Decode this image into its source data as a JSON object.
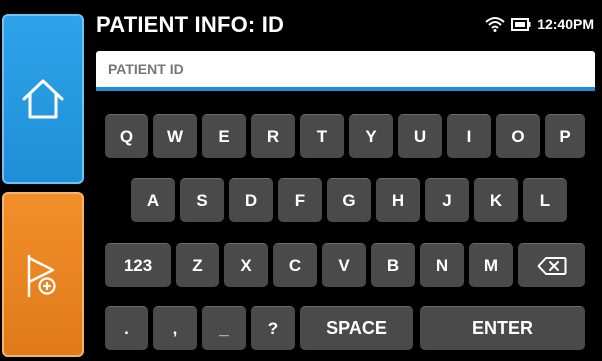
{
  "header": {
    "title": "PATIENT INFO: ID",
    "time": "12:40PM"
  },
  "status_icons": [
    "wifi-icon",
    "battery-icon"
  ],
  "sidebar": {
    "home_icon": "home-icon",
    "flag_icon": "flag-add-icon"
  },
  "input": {
    "placeholder": "PATIENT ID",
    "value": ""
  },
  "keyboard": {
    "row1": [
      "Q",
      "W",
      "E",
      "R",
      "T",
      "Y",
      "U",
      "I",
      "O",
      "P"
    ],
    "row2": [
      "A",
      "S",
      "D",
      "F",
      "G",
      "H",
      "J",
      "K",
      "L"
    ],
    "row3": [
      "123",
      "Z",
      "X",
      "C",
      "V",
      "B",
      "N",
      "M"
    ],
    "row4": [
      ".",
      ",",
      "_",
      "?"
    ],
    "space_label": "SPACE",
    "enter_label": "ENTER",
    "backspace_icon": "backspace-icon"
  },
  "colors": {
    "home_button": "#2196e3",
    "flag_button": "#e8841f",
    "key": "#4a4a4a",
    "input_underline": "#1c8fd8",
    "background": "#000000"
  }
}
